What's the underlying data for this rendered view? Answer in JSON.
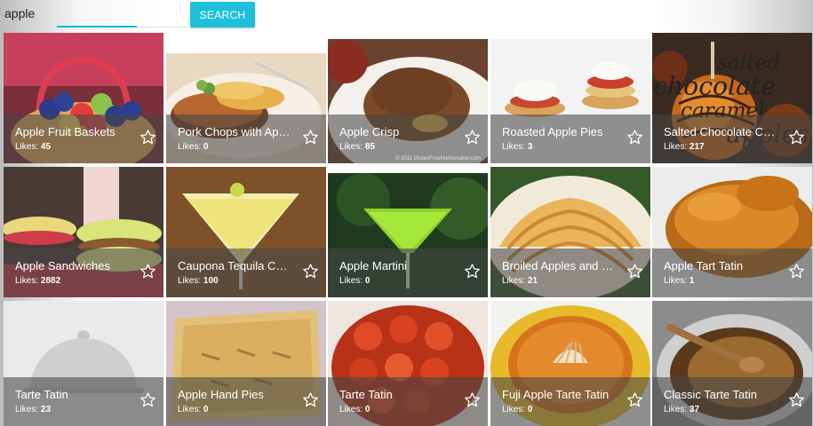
{
  "search": {
    "value": "apple",
    "placeholder": "",
    "button_label": "SEARCH",
    "accent_color": "#1fbfd9"
  },
  "results": {
    "likes_label": "Likes:",
    "items": [
      {
        "title": "Apple Fruit Baskets",
        "likes": "45",
        "image": "fruit-basket"
      },
      {
        "title": "Pork Chops with Apples",
        "likes": "0",
        "image": "pork-chops"
      },
      {
        "title": "Apple Crisp",
        "likes": "85",
        "image": "apple-crisp"
      },
      {
        "title": "Roasted Apple Pies",
        "likes": "3",
        "image": "roasted-pies"
      },
      {
        "title": "Salted Chocolate Caramel Apples",
        "likes": "217",
        "image": "caramel-apples"
      },
      {
        "title": "Apple Sandwiches",
        "likes": "2882",
        "image": "apple-sandwiches"
      },
      {
        "title": "Caupona Tequila Cocktail",
        "likes": "100",
        "image": "tequila-cocktail"
      },
      {
        "title": "Apple Martini",
        "likes": "0",
        "image": "apple-martini"
      },
      {
        "title": "Broiled Apples and Pears",
        "likes": "21",
        "image": "broiled-apples"
      },
      {
        "title": "Apple Tart Tatin",
        "likes": "1",
        "image": "tart-tatin"
      },
      {
        "title": "Tarte Tatin",
        "likes": "23",
        "image": "placeholder-cloche"
      },
      {
        "title": "Apple Hand Pies",
        "likes": "0",
        "image": "hand-pies"
      },
      {
        "title": "Tarte Tatin",
        "likes": "0",
        "image": "tarte-tatin-red"
      },
      {
        "title": "Fuji Apple Tarte Tatin",
        "likes": "0",
        "image": "fuji-tatin"
      },
      {
        "title": "Classic Tarte Tatin",
        "likes": "37",
        "image": "classic-tatin"
      }
    ]
  },
  "watermark": {
    "line1": "salted",
    "line2": "chocolate",
    "line3": "caramel",
    "line4": "apples"
  },
  "photo_credit": "© 2011 GlutenFreeHomemaker.com"
}
